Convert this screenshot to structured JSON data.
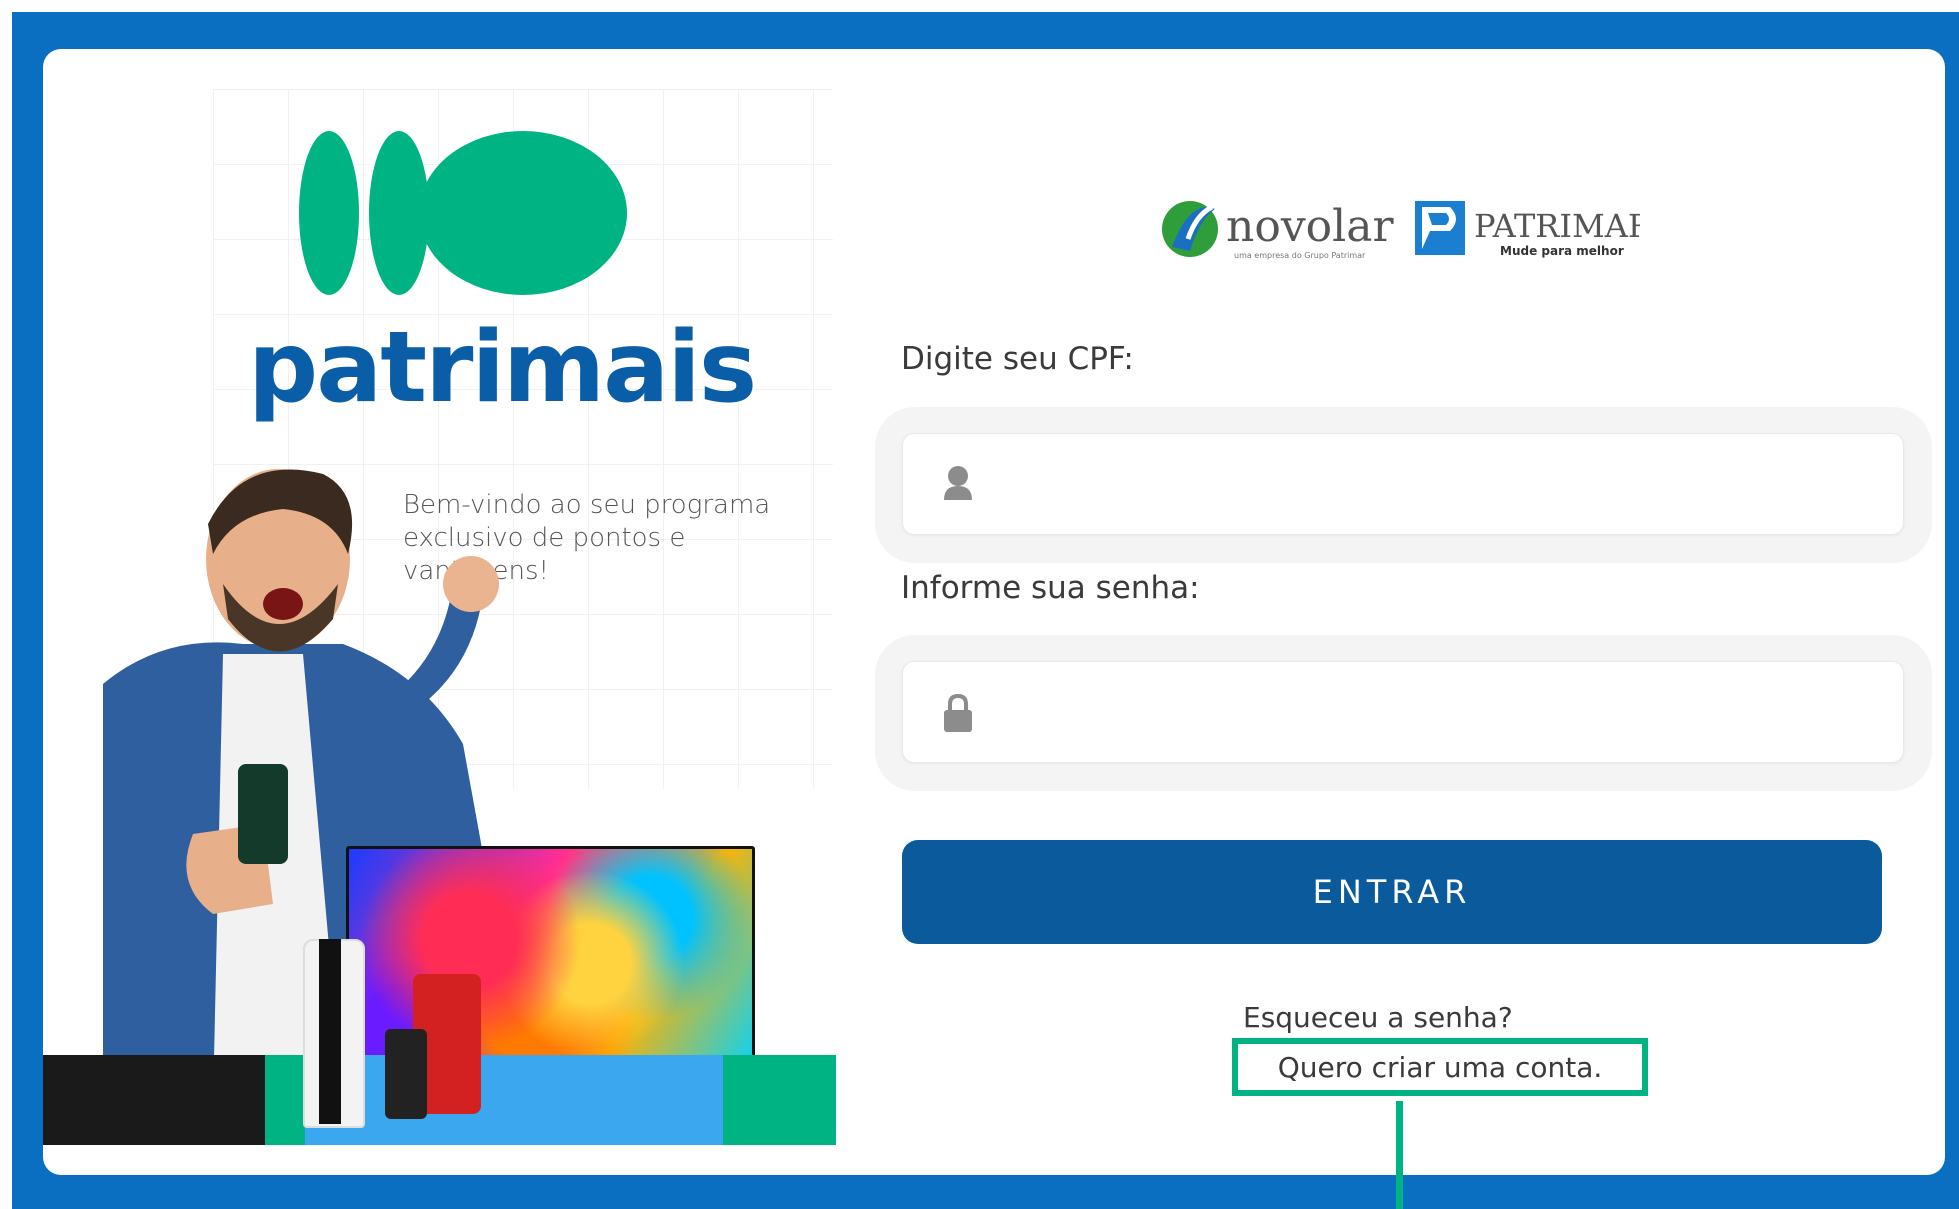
{
  "brand": {
    "name": "patrimais",
    "welcome": "Bem-vindo ao seu programa exclusivo de pontos e vantagens!",
    "primary_color": "#0a5ea8",
    "accent_color": "#00b383"
  },
  "partners": {
    "novolar": {
      "name": "novolar",
      "tagline": "uma empresa do Grupo Patrimar"
    },
    "patrimar": {
      "name": "PATRIMAR",
      "tagline": "Mude para melhor"
    }
  },
  "login": {
    "cpf_label": "Digite seu CPF:",
    "cpf_icon": "user-icon",
    "password_label": "Informe sua senha:",
    "password_icon": "lock-icon",
    "submit_label": "ENTRAR",
    "forgot_label": "Esqueceu a senha?",
    "create_account_label": "Quero criar uma conta."
  }
}
